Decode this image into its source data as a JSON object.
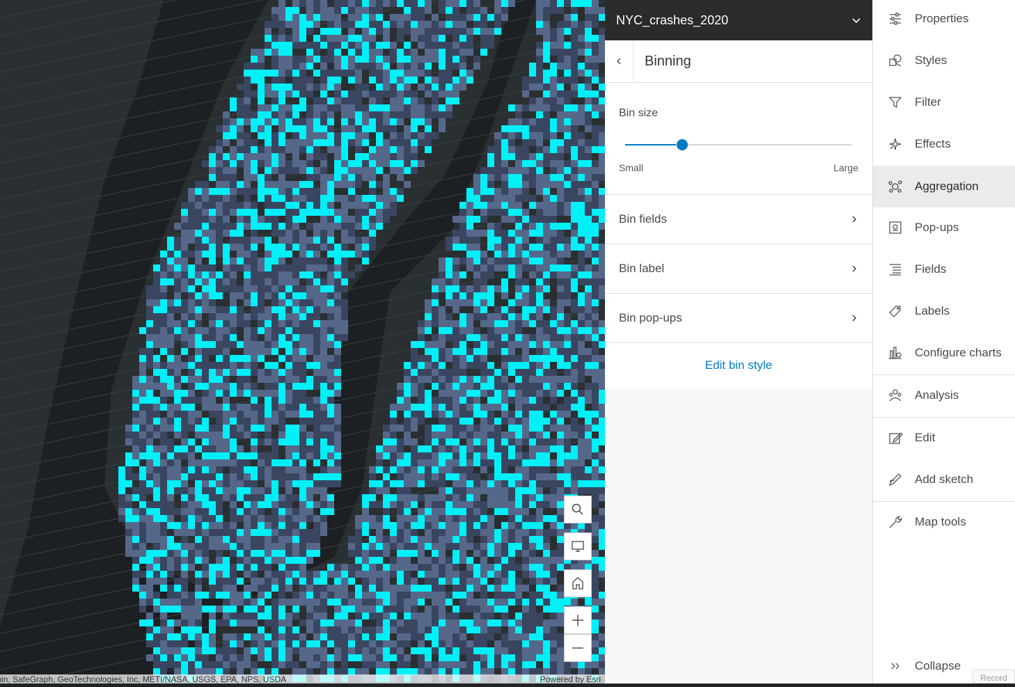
{
  "map": {
    "attribution_left": "min, SafeGraph, GeoTechnologies, Inc, METI/NASA, USGS, EPA, NPS, USDA",
    "attribution_right": "Powered by Esri",
    "controls": [
      {
        "name": "search-button",
        "icon": "search-icon"
      },
      {
        "name": "basemap-button",
        "icon": "monitor-icon"
      },
      {
        "name": "home-button",
        "icon": "home-icon"
      },
      {
        "name": "zoom-in-button",
        "icon": "plus-icon"
      },
      {
        "name": "zoom-out-button",
        "icon": "minus-icon"
      }
    ],
    "colors": {
      "land": "#2a2f31",
      "water": "#1c2022",
      "bin_low": "#3a4660",
      "bin_mid": "#56688a",
      "bin_high": "#00f0f8"
    }
  },
  "panel": {
    "layer_title": "NYC_crashes_2020",
    "sub_title": "Binning",
    "bin_size": {
      "label": "Bin size",
      "min_label": "Small",
      "max_label": "Large",
      "value_fraction": 0.25
    },
    "rows": [
      {
        "label": "Bin fields"
      },
      {
        "label": "Bin label"
      },
      {
        "label": "Bin pop-ups"
      }
    ],
    "edit_link": "Edit bin style",
    "accent": "#007ac2"
  },
  "tools": {
    "items": [
      {
        "label": "Properties",
        "icon": "properties-icon"
      },
      {
        "label": "Styles",
        "icon": "styles-icon"
      },
      {
        "label": "Filter",
        "icon": "filter-icon"
      },
      {
        "label": "Effects",
        "icon": "effects-icon"
      },
      {
        "label": "Aggregation",
        "icon": "aggregation-icon",
        "active": true
      },
      {
        "label": "Pop-ups",
        "icon": "popups-icon"
      },
      {
        "label": "Fields",
        "icon": "fields-icon"
      },
      {
        "label": "Labels",
        "icon": "labels-icon"
      },
      {
        "label": "Configure charts",
        "icon": "charts-icon"
      },
      {
        "label": "Analysis",
        "icon": "analysis-icon"
      },
      {
        "label": "Edit",
        "icon": "edit-icon"
      },
      {
        "label": "Add sketch",
        "icon": "sketch-icon"
      },
      {
        "label": "Map tools",
        "icon": "map-tools-icon"
      }
    ],
    "collapse_label": "Collapse",
    "record_label": "Record"
  }
}
